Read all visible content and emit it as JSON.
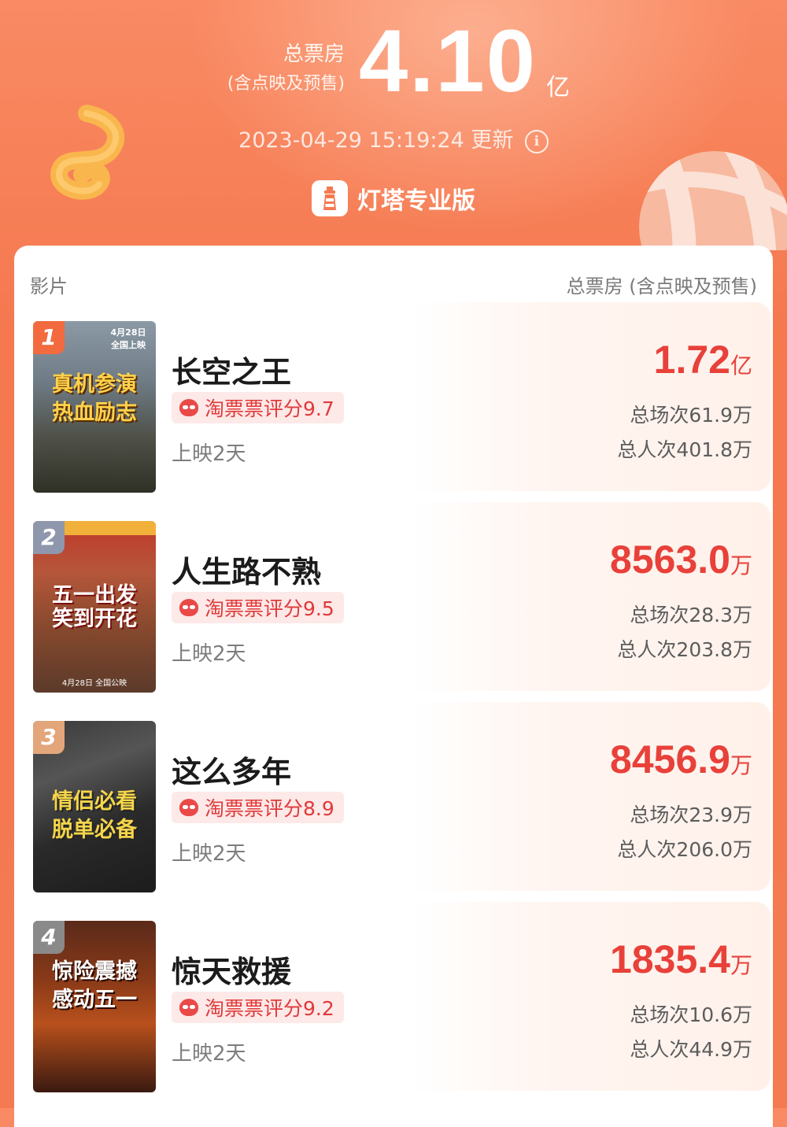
{
  "header": {
    "total_label": "总票房",
    "total_sublabel": "(含点映及预售)",
    "total_value": "4.10",
    "total_unit": "亿",
    "update_time": "2023-04-29 15:19:24",
    "update_suffix": "更新",
    "info_icon": "info-icon",
    "brand_name": "灯塔专业版",
    "brand_icon": "lighthouse-icon"
  },
  "table": {
    "col_film": "影片",
    "col_gross": "总票房 (含点映及预售)"
  },
  "movies": [
    {
      "rank": "1",
      "title": "长空之王",
      "rating": "淘票票评分9.7",
      "days": "上映2天",
      "gross_value": "1.72",
      "gross_unit": "亿",
      "shows": "总场次61.9万",
      "admissions": "总人次401.8万",
      "poster_text": [
        "真机参演",
        "热血励志"
      ],
      "poster_date": "4月28日 全国上映",
      "rank_color": "#f26a3e"
    },
    {
      "rank": "2",
      "title": "人生路不熟",
      "rating": "淘票票评分9.5",
      "days": "上映2天",
      "gross_value": "8563.0",
      "gross_unit": "万",
      "shows": "总场次28.3万",
      "admissions": "总人次203.8万",
      "poster_text": [
        "五一出发",
        "笑到开花"
      ],
      "poster_date": "4月28日 全国公映",
      "rank_color": "#8f97ad"
    },
    {
      "rank": "3",
      "title": "这么多年",
      "rating": "淘票票评分8.9",
      "days": "上映2天",
      "gross_value": "8456.9",
      "gross_unit": "万",
      "shows": "总场次23.9万",
      "admissions": "总人次206.0万",
      "poster_text": [
        "情侣必看",
        "脱单必备"
      ],
      "poster_date": "",
      "rank_color": "#e3a57a"
    },
    {
      "rank": "4",
      "title": "惊天救援",
      "rating": "淘票票评分9.2",
      "days": "上映2天",
      "gross_value": "1835.4",
      "gross_unit": "万",
      "shows": "总场次10.6万",
      "admissions": "总人次44.9万",
      "poster_text": [
        "惊险震撼",
        "感动五一"
      ],
      "poster_date": "",
      "rank_color": "#8a8a8a"
    }
  ]
}
